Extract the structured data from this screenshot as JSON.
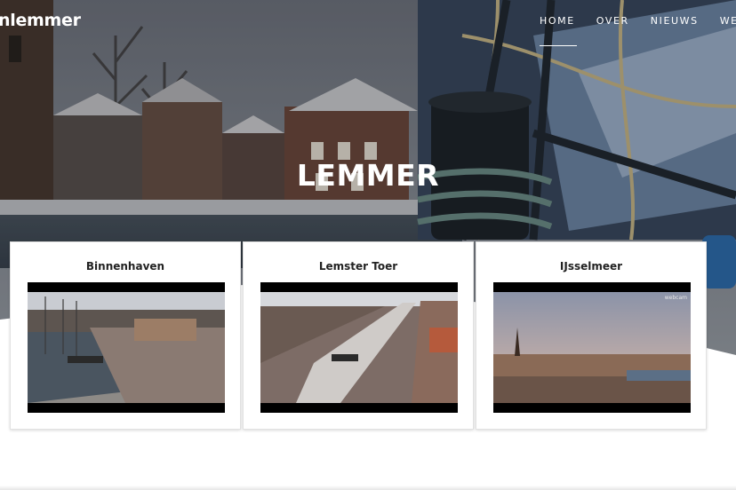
{
  "header": {
    "logo_text": "nlemmer",
    "nav": [
      {
        "label": "HOME",
        "active": true
      },
      {
        "label": "OVER",
        "active": false
      },
      {
        "label": "NIEUWS",
        "active": false
      },
      {
        "label": "WEBC",
        "active": false
      }
    ]
  },
  "hero": {
    "title": "LEMMER"
  },
  "webcams": [
    {
      "title": "Binnenhaven"
    },
    {
      "title": "Lemster Toer"
    },
    {
      "title": "IJsselmeer",
      "watermark": "webcam"
    }
  ]
}
